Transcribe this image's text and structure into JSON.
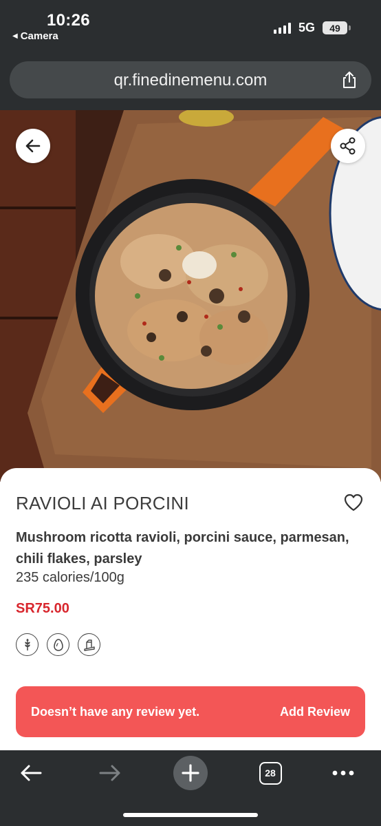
{
  "status_bar": {
    "time": "10:26",
    "back_app": "Camera",
    "network": "5G",
    "battery": "49"
  },
  "browser": {
    "url": "qr.finedinemenu.com",
    "open_tabs": "28"
  },
  "item": {
    "name": "RAVIOLI AI PORCINI",
    "description": "Mushroom ricotta ravioli, porcini sauce, parmesan, chili flakes, parsley",
    "calories": "235 calories/100g",
    "price": "SR75.00",
    "allergen_icons": [
      "wheat-icon",
      "egg-icon",
      "milk-icon"
    ]
  },
  "review": {
    "status": "Doesn’t have any review yet.",
    "action": "Add Review"
  },
  "colors": {
    "accent": "#f35656",
    "price": "#d8262d",
    "chrome": "#2b2e30"
  }
}
